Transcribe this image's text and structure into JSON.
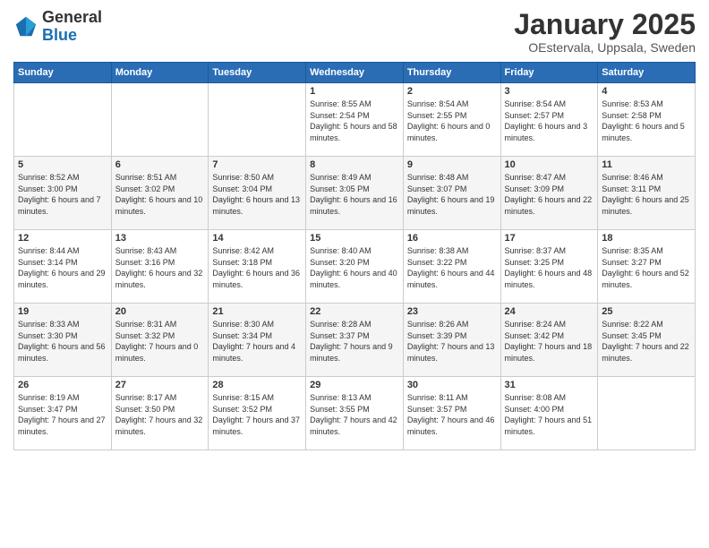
{
  "header": {
    "logo_general": "General",
    "logo_blue": "Blue",
    "month_title": "January 2025",
    "location": "OEstervala, Uppsala, Sweden"
  },
  "weekdays": [
    "Sunday",
    "Monday",
    "Tuesday",
    "Wednesday",
    "Thursday",
    "Friday",
    "Saturday"
  ],
  "weeks": [
    [
      {
        "day": "",
        "info": ""
      },
      {
        "day": "",
        "info": ""
      },
      {
        "day": "",
        "info": ""
      },
      {
        "day": "1",
        "info": "Sunrise: 8:55 AM\nSunset: 2:54 PM\nDaylight: 5 hours\nand 58 minutes."
      },
      {
        "day": "2",
        "info": "Sunrise: 8:54 AM\nSunset: 2:55 PM\nDaylight: 6 hours\nand 0 minutes."
      },
      {
        "day": "3",
        "info": "Sunrise: 8:54 AM\nSunset: 2:57 PM\nDaylight: 6 hours\nand 3 minutes."
      },
      {
        "day": "4",
        "info": "Sunrise: 8:53 AM\nSunset: 2:58 PM\nDaylight: 6 hours\nand 5 minutes."
      }
    ],
    [
      {
        "day": "5",
        "info": "Sunrise: 8:52 AM\nSunset: 3:00 PM\nDaylight: 6 hours\nand 7 minutes."
      },
      {
        "day": "6",
        "info": "Sunrise: 8:51 AM\nSunset: 3:02 PM\nDaylight: 6 hours\nand 10 minutes."
      },
      {
        "day": "7",
        "info": "Sunrise: 8:50 AM\nSunset: 3:04 PM\nDaylight: 6 hours\nand 13 minutes."
      },
      {
        "day": "8",
        "info": "Sunrise: 8:49 AM\nSunset: 3:05 PM\nDaylight: 6 hours\nand 16 minutes."
      },
      {
        "day": "9",
        "info": "Sunrise: 8:48 AM\nSunset: 3:07 PM\nDaylight: 6 hours\nand 19 minutes."
      },
      {
        "day": "10",
        "info": "Sunrise: 8:47 AM\nSunset: 3:09 PM\nDaylight: 6 hours\nand 22 minutes."
      },
      {
        "day": "11",
        "info": "Sunrise: 8:46 AM\nSunset: 3:11 PM\nDaylight: 6 hours\nand 25 minutes."
      }
    ],
    [
      {
        "day": "12",
        "info": "Sunrise: 8:44 AM\nSunset: 3:14 PM\nDaylight: 6 hours\nand 29 minutes."
      },
      {
        "day": "13",
        "info": "Sunrise: 8:43 AM\nSunset: 3:16 PM\nDaylight: 6 hours\nand 32 minutes."
      },
      {
        "day": "14",
        "info": "Sunrise: 8:42 AM\nSunset: 3:18 PM\nDaylight: 6 hours\nand 36 minutes."
      },
      {
        "day": "15",
        "info": "Sunrise: 8:40 AM\nSunset: 3:20 PM\nDaylight: 6 hours\nand 40 minutes."
      },
      {
        "day": "16",
        "info": "Sunrise: 8:38 AM\nSunset: 3:22 PM\nDaylight: 6 hours\nand 44 minutes."
      },
      {
        "day": "17",
        "info": "Sunrise: 8:37 AM\nSunset: 3:25 PM\nDaylight: 6 hours\nand 48 minutes."
      },
      {
        "day": "18",
        "info": "Sunrise: 8:35 AM\nSunset: 3:27 PM\nDaylight: 6 hours\nand 52 minutes."
      }
    ],
    [
      {
        "day": "19",
        "info": "Sunrise: 8:33 AM\nSunset: 3:30 PM\nDaylight: 6 hours\nand 56 minutes."
      },
      {
        "day": "20",
        "info": "Sunrise: 8:31 AM\nSunset: 3:32 PM\nDaylight: 7 hours\nand 0 minutes."
      },
      {
        "day": "21",
        "info": "Sunrise: 8:30 AM\nSunset: 3:34 PM\nDaylight: 7 hours\nand 4 minutes."
      },
      {
        "day": "22",
        "info": "Sunrise: 8:28 AM\nSunset: 3:37 PM\nDaylight: 7 hours\nand 9 minutes."
      },
      {
        "day": "23",
        "info": "Sunrise: 8:26 AM\nSunset: 3:39 PM\nDaylight: 7 hours\nand 13 minutes."
      },
      {
        "day": "24",
        "info": "Sunrise: 8:24 AM\nSunset: 3:42 PM\nDaylight: 7 hours\nand 18 minutes."
      },
      {
        "day": "25",
        "info": "Sunrise: 8:22 AM\nSunset: 3:45 PM\nDaylight: 7 hours\nand 22 minutes."
      }
    ],
    [
      {
        "day": "26",
        "info": "Sunrise: 8:19 AM\nSunset: 3:47 PM\nDaylight: 7 hours\nand 27 minutes."
      },
      {
        "day": "27",
        "info": "Sunrise: 8:17 AM\nSunset: 3:50 PM\nDaylight: 7 hours\nand 32 minutes."
      },
      {
        "day": "28",
        "info": "Sunrise: 8:15 AM\nSunset: 3:52 PM\nDaylight: 7 hours\nand 37 minutes."
      },
      {
        "day": "29",
        "info": "Sunrise: 8:13 AM\nSunset: 3:55 PM\nDaylight: 7 hours\nand 42 minutes."
      },
      {
        "day": "30",
        "info": "Sunrise: 8:11 AM\nSunset: 3:57 PM\nDaylight: 7 hours\nand 46 minutes."
      },
      {
        "day": "31",
        "info": "Sunrise: 8:08 AM\nSunset: 4:00 PM\nDaylight: 7 hours\nand 51 minutes."
      },
      {
        "day": "",
        "info": ""
      }
    ]
  ]
}
